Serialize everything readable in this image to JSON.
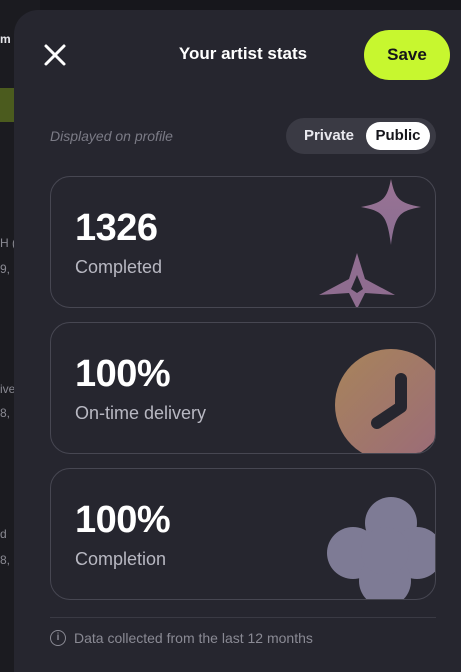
{
  "background": {
    "fragments": [
      "m",
      "H (",
      "9,",
      "ive",
      "8,",
      "d",
      "8,"
    ]
  },
  "header": {
    "title": "Your artist stats",
    "save_label": "Save"
  },
  "visibility": {
    "label": "Displayed on profile",
    "options": [
      "Private",
      "Public"
    ],
    "selected": "Public"
  },
  "stats": [
    {
      "value": "1326",
      "label": "Completed",
      "icon": "sparkle-stars-icon"
    },
    {
      "value": "100%",
      "label": "On-time delivery",
      "icon": "clock-icon"
    },
    {
      "value": "100%",
      "label": "Completion",
      "icon": "flower-icon"
    }
  ],
  "footer": {
    "note": "Data collected from the last 12 months"
  },
  "colors": {
    "accent": "#c7f72f",
    "panel": "#26262f",
    "page": "#17171c"
  }
}
